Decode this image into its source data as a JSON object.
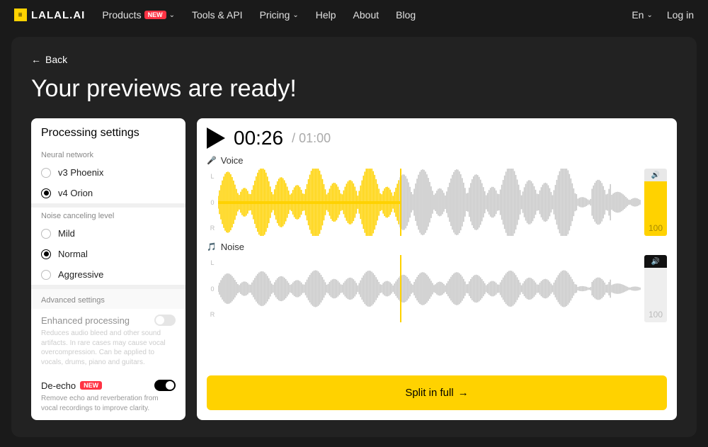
{
  "brand": "LALAL.AI",
  "nav": {
    "products": "Products",
    "tools": "Tools & API",
    "pricing": "Pricing",
    "help": "Help",
    "about": "About",
    "blog": "Blog",
    "lang": "En",
    "login": "Log in",
    "new_badge": "NEW"
  },
  "back": "Back",
  "title": "Your previews are ready!",
  "settings": {
    "title": "Processing settings",
    "neural_label": "Neural network",
    "neural": [
      {
        "label": "v3 Phoenix",
        "selected": false
      },
      {
        "label": "v4 Orion",
        "selected": true
      }
    ],
    "noise_label": "Noise canceling level",
    "noise": [
      {
        "label": "Mild",
        "selected": false
      },
      {
        "label": "Normal",
        "selected": true
      },
      {
        "label": "Aggressive",
        "selected": false
      }
    ],
    "advanced_label": "Advanced settings",
    "enhanced": {
      "title": "Enhanced processing",
      "desc": "Reduces audio bleed and other sound artifacts. In rare cases may cause vocal overcompression. Can be applied to vocals, drums, piano and guitars.",
      "on": false
    },
    "deecho": {
      "title": "De-echo",
      "badge": "NEW",
      "desc": "Remove echo and reverberation from vocal recordings to improve clarity.",
      "on": true
    }
  },
  "player": {
    "current": "00:26",
    "total": "/ 01:00",
    "playhead_pct": 43,
    "tracks": {
      "voice": {
        "label": "Voice",
        "volume": "100",
        "channels": [
          "L",
          "0",
          "R"
        ]
      },
      "noise": {
        "label": "Noise",
        "volume": "100",
        "channels": [
          "L",
          "0",
          "R"
        ]
      }
    },
    "split_label": "Split in full"
  }
}
